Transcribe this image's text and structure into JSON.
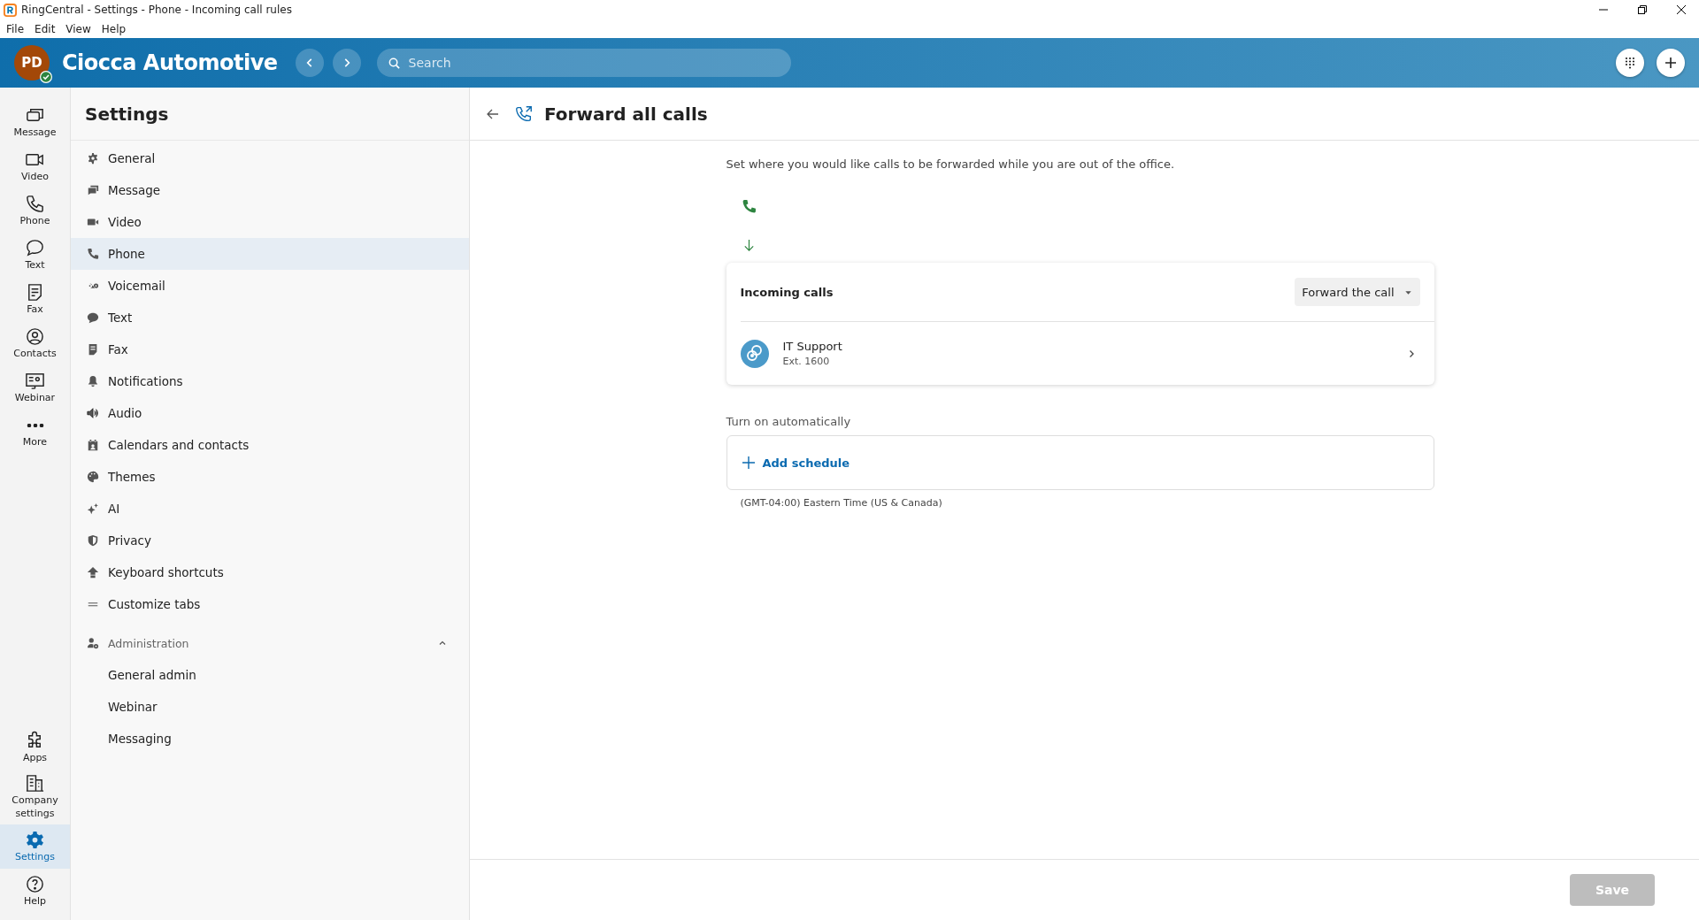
{
  "window": {
    "title": "RingCentral - Settings - Phone - Incoming call rules"
  },
  "menu": [
    "File",
    "Edit",
    "View",
    "Help"
  ],
  "header": {
    "avatar": "PD",
    "org": "Ciocca Automotive",
    "search": {
      "placeholder": "Search"
    }
  },
  "rail": {
    "top": [
      {
        "label": "Message",
        "selected": false
      },
      {
        "label": "Video",
        "selected": false
      },
      {
        "label": "Phone",
        "selected": false
      },
      {
        "label": "Text",
        "selected": false
      },
      {
        "label": "Fax",
        "selected": false
      },
      {
        "label": "Contacts",
        "selected": false
      },
      {
        "label": "Webinar",
        "selected": false
      },
      {
        "label": "More",
        "selected": false
      }
    ],
    "bottom": [
      {
        "label": "Apps",
        "selected": false
      },
      {
        "label": "Company settings",
        "selected": false
      },
      {
        "label": "Settings",
        "selected": true
      },
      {
        "label": "Help",
        "selected": false
      }
    ]
  },
  "settings": {
    "title": "Settings",
    "items": [
      {
        "label": "General",
        "selected": false
      },
      {
        "label": "Message",
        "selected": false
      },
      {
        "label": "Video",
        "selected": false
      },
      {
        "label": "Phone",
        "selected": true
      },
      {
        "label": "Voicemail",
        "selected": false
      },
      {
        "label": "Text",
        "selected": false
      },
      {
        "label": "Fax",
        "selected": false
      },
      {
        "label": "Notifications",
        "selected": false
      },
      {
        "label": "Audio",
        "selected": false
      },
      {
        "label": "Calendars and contacts",
        "selected": false
      },
      {
        "label": "Themes",
        "selected": false
      },
      {
        "label": "AI",
        "selected": false
      },
      {
        "label": "Privacy",
        "selected": false
      },
      {
        "label": "Keyboard shortcuts",
        "selected": false
      },
      {
        "label": "Customize tabs",
        "selected": false
      }
    ],
    "admin": {
      "label": "Administration",
      "expanded": true,
      "children": [
        {
          "label": "General admin",
          "selected": false
        },
        {
          "label": "Webinar",
          "selected": false
        },
        {
          "label": "Messaging",
          "selected": false
        }
      ]
    }
  },
  "page": {
    "title": "Forward all calls",
    "description": "Set where you would like calls to be forwarded while you are out of the office.",
    "rule": {
      "label": "Incoming calls",
      "action": "Forward the call",
      "target": {
        "name": "IT Support",
        "ext": "Ext. 1600"
      }
    },
    "auto": {
      "label": "Turn on automatically",
      "add": "Add schedule",
      "timezone": "(GMT-04:00) Eastern Time (US & Canada)"
    }
  },
  "save": {
    "label": "Save",
    "disabled": true
  }
}
